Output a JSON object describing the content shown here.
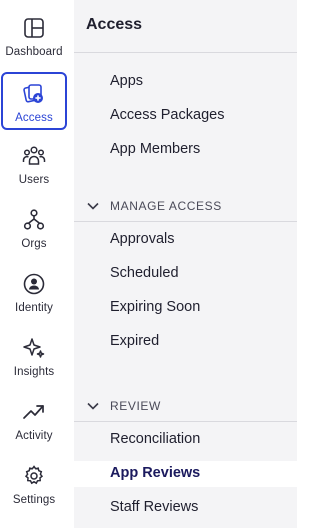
{
  "rail": {
    "items": [
      {
        "label": "Dashboard",
        "icon": "dashboard-icon"
      },
      {
        "label": "Access",
        "icon": "access-icon"
      },
      {
        "label": "Users",
        "icon": "users-icon"
      },
      {
        "label": "Orgs",
        "icon": "orgs-icon"
      },
      {
        "label": "Identity",
        "icon": "identity-icon"
      },
      {
        "label": "Insights",
        "icon": "insights-icon"
      },
      {
        "label": "Activity",
        "icon": "activity-icon"
      },
      {
        "label": "Settings",
        "icon": "settings-icon"
      }
    ],
    "active": "Access",
    "accent_color": "#2b44d6"
  },
  "panel": {
    "title": "Access",
    "top_links": [
      "Apps",
      "Access Packages",
      "App Members"
    ],
    "manage_access": {
      "heading": "MANAGE ACCESS",
      "links": [
        "Approvals",
        "Scheduled",
        "Expiring Soon",
        "Expired"
      ]
    },
    "review": {
      "heading": "REVIEW",
      "links": [
        "Reconciliation",
        "App Reviews",
        "Staff Reviews"
      ]
    },
    "current_link": "App Reviews",
    "current_color": "#1b1a5e"
  }
}
